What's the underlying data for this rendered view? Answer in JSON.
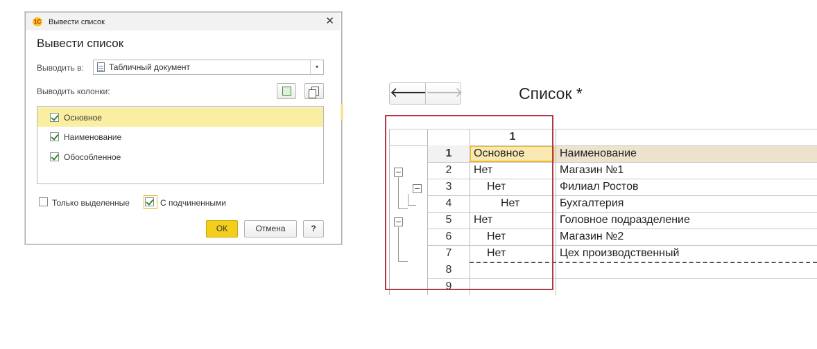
{
  "dialog": {
    "window_title": "Вывести список",
    "logo_text": "1С",
    "close_glyph": "✕",
    "heading": "Вывести список",
    "output_label": "Выводить в:",
    "output_value": "Табличный документ",
    "dropdown_glyph": "▾",
    "columns_label": "Выводить колонки:",
    "columns": [
      {
        "label": "Основное",
        "checked": true,
        "selected": true
      },
      {
        "label": "Наименование",
        "checked": true,
        "selected": false
      },
      {
        "label": "Обособленное",
        "checked": true,
        "selected": false
      }
    ],
    "only_selected_label": "Только выделенные",
    "only_selected_checked": false,
    "with_children_label": "С подчиненными",
    "with_children_checked": true,
    "ok_label": "ОК",
    "cancel_label": "Отмена",
    "help_label": "?"
  },
  "nav": {
    "back_glyph": "🡐",
    "forward_glyph": "🡒"
  },
  "page_title": "Список *",
  "sheet": {
    "column_header": "1",
    "rows": [
      {
        "num": "1",
        "col1": "Основное",
        "col2": "Наименование"
      },
      {
        "num": "2",
        "col1": "Нет",
        "col2": "Магазин №1"
      },
      {
        "num": "3",
        "col1": "Нет",
        "col2": "Филиал Ростов"
      },
      {
        "num": "4",
        "col1": "Нет",
        "col2": "Бухгалтерия"
      },
      {
        "num": "5",
        "col1": "Нет",
        "col2": "Головное подразделение"
      },
      {
        "num": "6",
        "col1": "Нет",
        "col2": "Магазин №2"
      },
      {
        "num": "7",
        "col1": "Нет",
        "col2": "Цех производственный"
      },
      {
        "num": "8",
        "col1": "",
        "col2": ""
      },
      {
        "num": "9",
        "col1": "",
        "col2": ""
      }
    ]
  },
  "colors": {
    "accent_yellow": "#f3cf1b",
    "highlight_frame": "#b23a48",
    "header_row": "#ede2cc"
  }
}
